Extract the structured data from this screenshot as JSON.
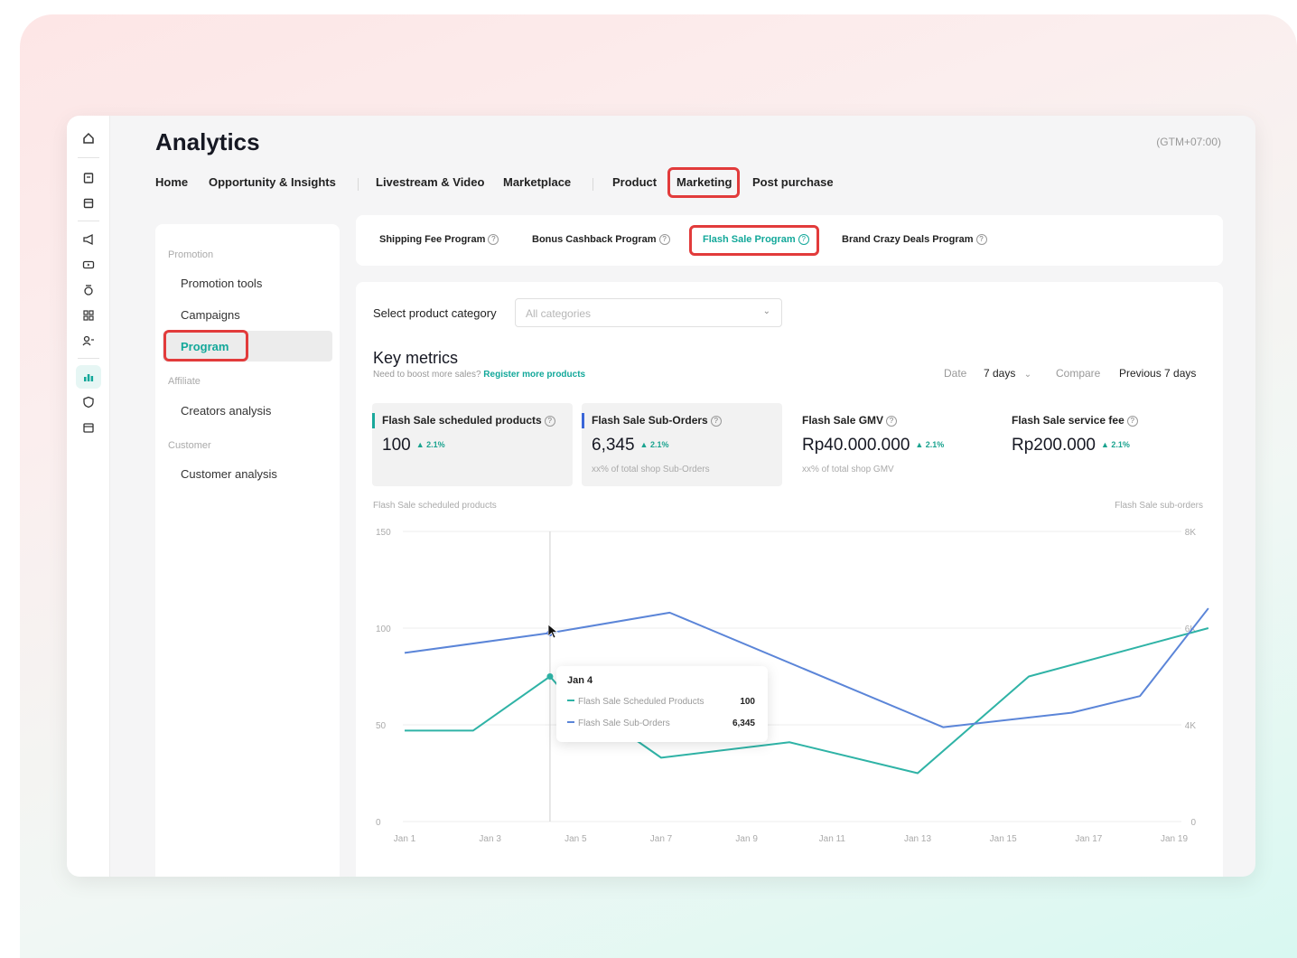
{
  "app": {
    "title": "Analytics",
    "timezone": "(GTM+07:00)"
  },
  "topnav": {
    "items": [
      "Home",
      "Opportunity & Insights",
      "Livestream & Video",
      "Marketplace",
      "Product",
      "Marketing",
      "Post purchase"
    ],
    "active": "Marketing"
  },
  "sidebar": {
    "sections": [
      {
        "label": "Promotion",
        "items": [
          "Promotion tools",
          "Campaigns",
          "Program"
        ]
      },
      {
        "label": "Affiliate",
        "items": [
          "Creators analysis"
        ]
      },
      {
        "label": "Customer",
        "items": [
          "Customer analysis"
        ]
      }
    ],
    "active": "Program"
  },
  "subtabs": {
    "items": [
      "Shipping Fee Program",
      "Bonus Cashback Program",
      "Flash Sale Program",
      "Brand Crazy Deals Program"
    ],
    "active": "Flash Sale Program",
    "help_glyph": "?"
  },
  "filters": {
    "category_label": "Select product category",
    "category_placeholder": "All categories"
  },
  "key_metrics": {
    "title": "Key metrics",
    "hint": "Need to boost more sales?",
    "hint_link": "Register more products",
    "date_label": "Date",
    "date_value": "7 days",
    "compare_label": "Compare",
    "compare_value": "Previous 7 days",
    "cards": [
      {
        "label": "Flash Sale scheduled products",
        "value": "100",
        "change": "▲ 2.1%",
        "sub": "",
        "selected": true,
        "color": "#19a89b"
      },
      {
        "label": "Flash Sale Sub-Orders",
        "value": "6,345",
        "change": "▲ 2.1%",
        "sub": "xx% of total shop Sub-Orders",
        "selected": true,
        "color": "#3a66d8"
      },
      {
        "label": "Flash Sale GMV",
        "value": "Rp40.000.000",
        "change": "▲ 2.1%",
        "sub": "xx% of total shop GMV",
        "selected": false,
        "color": ""
      },
      {
        "label": "Flash Sale service fee",
        "value": "Rp200.000",
        "change": "▲ 2.1%",
        "sub": "",
        "selected": false,
        "color": ""
      }
    ]
  },
  "chart_data": {
    "type": "line",
    "left_axis_title": "Flash Sale scheduled products",
    "right_axis_title": "Flash Sale sub-orders",
    "y_left": {
      "ticks": [
        "150",
        "100",
        "50",
        "0"
      ],
      "range": [
        0,
        150
      ]
    },
    "y_right": {
      "ticks": [
        "8K",
        "6K",
        "4K",
        "0"
      ],
      "range": [
        0,
        6000
      ]
    },
    "x_ticks": [
      "Jan 1",
      "Jan 3",
      "Jan 5",
      "Jan 7",
      "Jan 9",
      "Jan 11",
      "Jan 13",
      "Jan 15",
      "Jan 17",
      "Jan 19"
    ],
    "series": [
      {
        "name": "Flash Sale Scheduled Products",
        "color": "#2fb3a6",
        "points": [
          [
            0,
            47
          ],
          [
            0.8,
            47
          ],
          [
            1.7,
            75
          ],
          [
            1.8,
            70
          ],
          [
            3.0,
            33
          ],
          [
            4.5,
            41
          ],
          [
            6.0,
            25
          ],
          [
            7.3,
            75
          ],
          [
            9.4,
            100
          ]
        ]
      },
      {
        "name": "Flash Sale Sub-Orders",
        "color": "#5b85d8",
        "points": [
          [
            0,
            4650
          ],
          [
            1.7,
            5200
          ],
          [
            3.1,
            5760
          ],
          [
            6.3,
            2600
          ],
          [
            7.8,
            3000
          ],
          [
            8.6,
            3460
          ],
          [
            9.4,
            5880
          ]
        ]
      }
    ],
    "tooltip": {
      "date": "Jan 4",
      "rows": [
        {
          "label": "Flash Sale Scheduled Products",
          "value": "100"
        },
        {
          "label": "Flash Sale Sub-Orders",
          "value": "6,345"
        }
      ]
    }
  }
}
